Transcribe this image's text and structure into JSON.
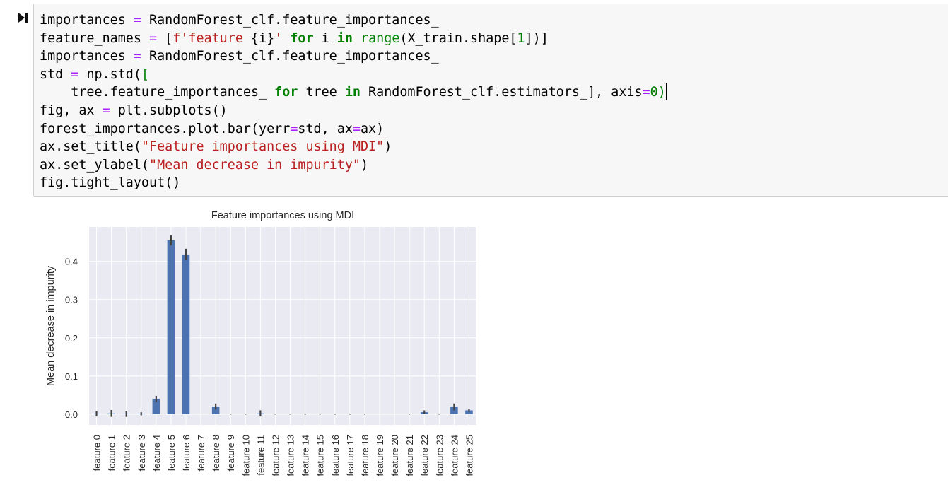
{
  "cell": {
    "code_lines": [
      [
        [
          "importances ",
          ""
        ],
        [
          "=",
          "op"
        ],
        [
          " RandomForest_clf.feature_importances_",
          ""
        ]
      ],
      [
        [
          "feature_names ",
          ""
        ],
        [
          "=",
          "op"
        ],
        [
          " [",
          ""
        ],
        [
          "f'feature ",
          "str"
        ],
        [
          "{i}",
          ""
        ],
        [
          "'",
          "str"
        ],
        [
          " ",
          ""
        ],
        [
          "for",
          "kw"
        ],
        [
          " i ",
          ""
        ],
        [
          "in",
          "kw"
        ],
        [
          " ",
          ""
        ],
        [
          "range",
          "bi"
        ],
        [
          "(X_train.shape[",
          ""
        ],
        [
          "1",
          "num"
        ],
        [
          "])]",
          ""
        ]
      ],
      [
        [
          "importances ",
          ""
        ],
        [
          "=",
          "op"
        ],
        [
          " RandomForest_clf.feature_importances_",
          ""
        ]
      ],
      [
        [
          "std ",
          ""
        ],
        [
          "=",
          "op"
        ],
        [
          " np.std(",
          ""
        ],
        [
          "[",
          "bi"
        ]
      ],
      [
        [
          "    tree.feature_importances_ ",
          ""
        ],
        [
          "for",
          "kw"
        ],
        [
          " tree ",
          ""
        ],
        [
          "in",
          "kw"
        ],
        [
          " RandomForest_clf.estimators_], axis",
          ""
        ],
        [
          "=",
          "op"
        ],
        [
          "0",
          "num"
        ],
        [
          ")",
          "bi"
        ]
      ],
      [
        [
          "fig, ax ",
          ""
        ],
        [
          "=",
          "op"
        ],
        [
          " plt.subplots()",
          ""
        ]
      ],
      [
        [
          "forest_importances.plot.bar(yerr",
          ""
        ],
        [
          "=",
          "op"
        ],
        [
          "std, ax",
          ""
        ],
        [
          "=",
          "op"
        ],
        [
          "ax)",
          ""
        ]
      ],
      [
        [
          "ax.set_title(",
          ""
        ],
        [
          "\"Feature importances using MDI\"",
          "str"
        ],
        [
          ")",
          ""
        ]
      ],
      [
        [
          "ax.set_ylabel(",
          ""
        ],
        [
          "\"Mean decrease in impurity\"",
          "str"
        ],
        [
          ")",
          ""
        ]
      ],
      [
        [
          "fig.tight_layout()",
          ""
        ]
      ]
    ]
  },
  "chart_data": {
    "type": "bar",
    "title": "Feature importances using MDI",
    "xlabel": "",
    "ylabel": "Mean decrease in impurity",
    "ylim": [
      -0.028,
      0.49
    ],
    "yticks": [
      "0.0",
      "0.1",
      "0.2",
      "0.3",
      "0.4"
    ],
    "grid": true,
    "categories": [
      "feature 0",
      "feature 1",
      "feature 2",
      "feature 3",
      "feature 4",
      "feature 5",
      "feature 6",
      "feature 7",
      "feature 8",
      "feature 9",
      "feature 10",
      "feature 11",
      "feature 12",
      "feature 13",
      "feature 14",
      "feature 15",
      "feature 16",
      "feature 17",
      "feature 18",
      "feature 19",
      "feature 20",
      "feature 21",
      "feature 22",
      "feature 23",
      "feature 24",
      "feature 25"
    ],
    "values": [
      0.001,
      0.002,
      0.001,
      0.001,
      0.04,
      0.455,
      0.418,
      0.0,
      0.02,
      0.0,
      0.0,
      0.002,
      0.0,
      0.0,
      0.0,
      0.0,
      0.0,
      0.0,
      0.0,
      0.0,
      0.0,
      0.0,
      0.005,
      0.0,
      0.019,
      0.01
    ],
    "errors": [
      0.007,
      0.009,
      0.008,
      0.004,
      0.008,
      0.013,
      0.015,
      0.0,
      0.008,
      0.001,
      0.001,
      0.008,
      0.001,
      0.001,
      0.001,
      0.001,
      0.001,
      0.001,
      0.001,
      0.0,
      0.0,
      0.001,
      0.005,
      0.001,
      0.009,
      0.004
    ],
    "colors": {
      "bar": "#4c72b0",
      "error": "#424242",
      "axes_bg": "#eaeaf2",
      "grid": "#ffffff",
      "text": "#262626"
    }
  }
}
